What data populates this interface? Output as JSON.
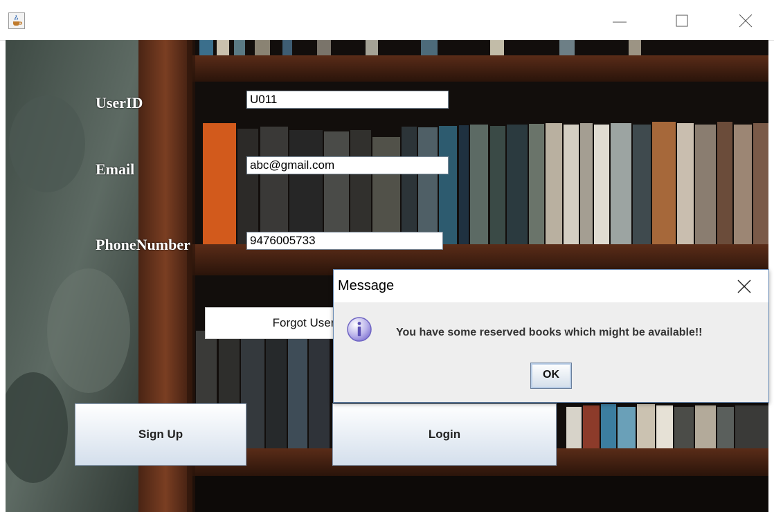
{
  "form": {
    "userid_label": "UserID",
    "email_label": "Email",
    "phone_label": "PhoneNumber",
    "userid_value": "U011",
    "email_value": "abc@gmail.com",
    "phone_value": "9476005733"
  },
  "buttons": {
    "forgot_userid": "Forgot UserID",
    "sign_up": "Sign Up",
    "login": "Login"
  },
  "dialog": {
    "title": "Message",
    "message": "You have some reserved books which might be available!!",
    "ok_label": "OK"
  },
  "colors": {
    "button_gradient_bottom": "#d4dfec",
    "dialog_border": "#6a8cb5",
    "info_icon": "#7c6fd0"
  },
  "icons": {
    "app": "java-coffee-cup-icon",
    "info": "info-icon"
  }
}
